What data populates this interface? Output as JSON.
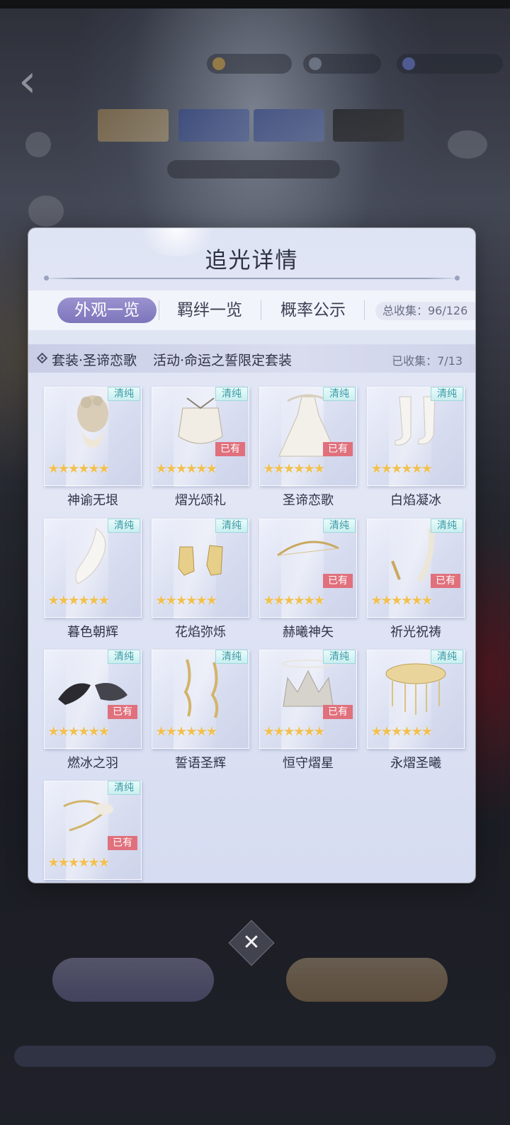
{
  "panel": {
    "title": "追光详情",
    "tabs": [
      {
        "label": "外观一览",
        "active": true
      },
      {
        "label": "羁绊一览",
        "active": false
      },
      {
        "label": "概率公示",
        "active": false
      }
    ],
    "total_collected": "总收集：96/126"
  },
  "suit": {
    "name": "套装·圣谛恋歌",
    "event": "活动·命运之誓限定套装",
    "collected": "已收集：7/13"
  },
  "labels": {
    "pure_tag": "清纯",
    "owned_tag": "已有",
    "stars": "★★★★★★"
  },
  "items": [
    {
      "name": "神谕无垠",
      "owned": false,
      "art": "hair-icon"
    },
    {
      "name": "熠光颂礼",
      "owned": true,
      "art": "top-icon"
    },
    {
      "name": "圣谛恋歌",
      "owned": true,
      "art": "dress-icon"
    },
    {
      "name": "白焰凝冰",
      "owned": false,
      "art": "stockings-icon"
    },
    {
      "name": "暮色朝辉",
      "owned": false,
      "art": "veil-icon"
    },
    {
      "name": "花焰弥烁",
      "owned": false,
      "art": "shoes-icon"
    },
    {
      "name": "赫曦神矢",
      "owned": true,
      "art": "bow-icon"
    },
    {
      "name": "祈光祝祷",
      "owned": true,
      "art": "staff-icon"
    },
    {
      "name": "燃冰之羽",
      "owned": true,
      "art": "wings-icon"
    },
    {
      "name": "誓语圣辉",
      "owned": false,
      "art": "earrings-icon"
    },
    {
      "name": "恒守熠星",
      "owned": true,
      "art": "crown-icon"
    },
    {
      "name": "永熠圣曦",
      "owned": false,
      "art": "headpiece-icon"
    },
    {
      "name": "",
      "owned": true,
      "art": "accessory-icon"
    }
  ],
  "colors": {
    "active_tab": "#8a83c6",
    "owned_tag": "#e0707c",
    "pure_tag": "#3a9aa4",
    "star": "#f2c04c"
  }
}
